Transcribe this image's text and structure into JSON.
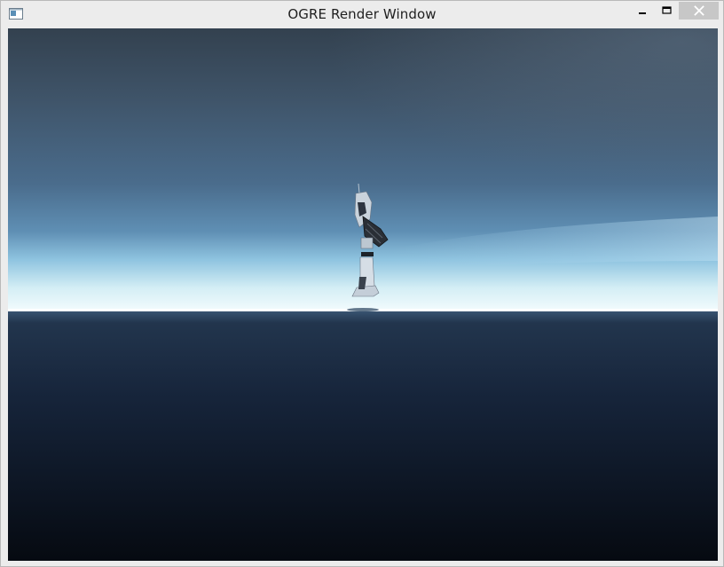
{
  "window": {
    "title": "OGRE Render Window"
  },
  "icons": {
    "app": "app-window-icon",
    "minimize": "minimize-icon",
    "maximize": "maximize-icon",
    "close": "close-icon"
  },
  "colors": {
    "sky_top": "#3a4a5d",
    "sky_mid": "#4a6f92",
    "horizon_glow": "#e6f6fb",
    "ocean_near_horizon": "#2a3e57",
    "ocean_bottom": "#070c14",
    "close_button": "#c7c7c7"
  }
}
